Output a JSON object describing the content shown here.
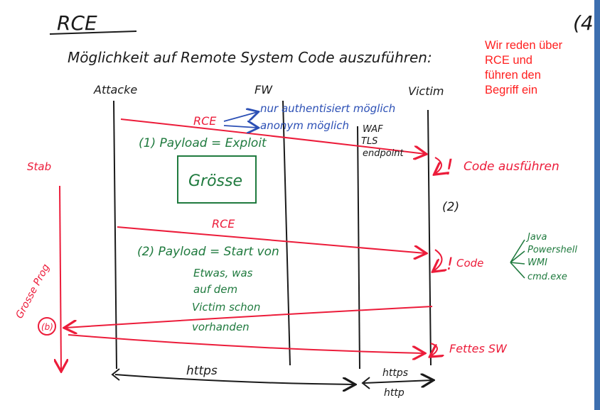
{
  "title": "RCE",
  "page_number": "(4",
  "subtitle": "Möglichkeit auf Remote System Code auszuführen:",
  "note": "Wir reden über RCE und führen den Begriff ein",
  "columns": {
    "attacker": "Attacke",
    "fw": "FW",
    "victim": "Victim"
  },
  "rce_labels": {
    "first": "RCE",
    "second": "RCE"
  },
  "fw_notes": [
    "nur authentisiert möglich",
    "anonym möglich"
  ],
  "victim_defenses": [
    "WAF",
    "TLS",
    "endpoint"
  ],
  "payload1": "(1) Payload = Exploit",
  "size_box": "Grösse",
  "step2": "(2)",
  "code_execute": "Code ausführen",
  "code_short": "Code",
  "payload2_lines": [
    "(2) Payload = Start von",
    "Etwas, was",
    "auf dem",
    "Victim schon",
    "vorhanden"
  ],
  "code_options": [
    "Java",
    "Powershell",
    "WMI",
    "cmd.exe"
  ],
  "left_label": "Stab",
  "big_prog": "Grosse Prog",
  "circle_label": "(b)",
  "fettes": "Fettes SW",
  "https": "https",
  "https2": "https",
  "http": "http",
  "colors": {
    "ink": "#1a1a1a",
    "red": "#ec1c3a",
    "green": "#1f7a3e",
    "note": "#ff1f1f"
  }
}
